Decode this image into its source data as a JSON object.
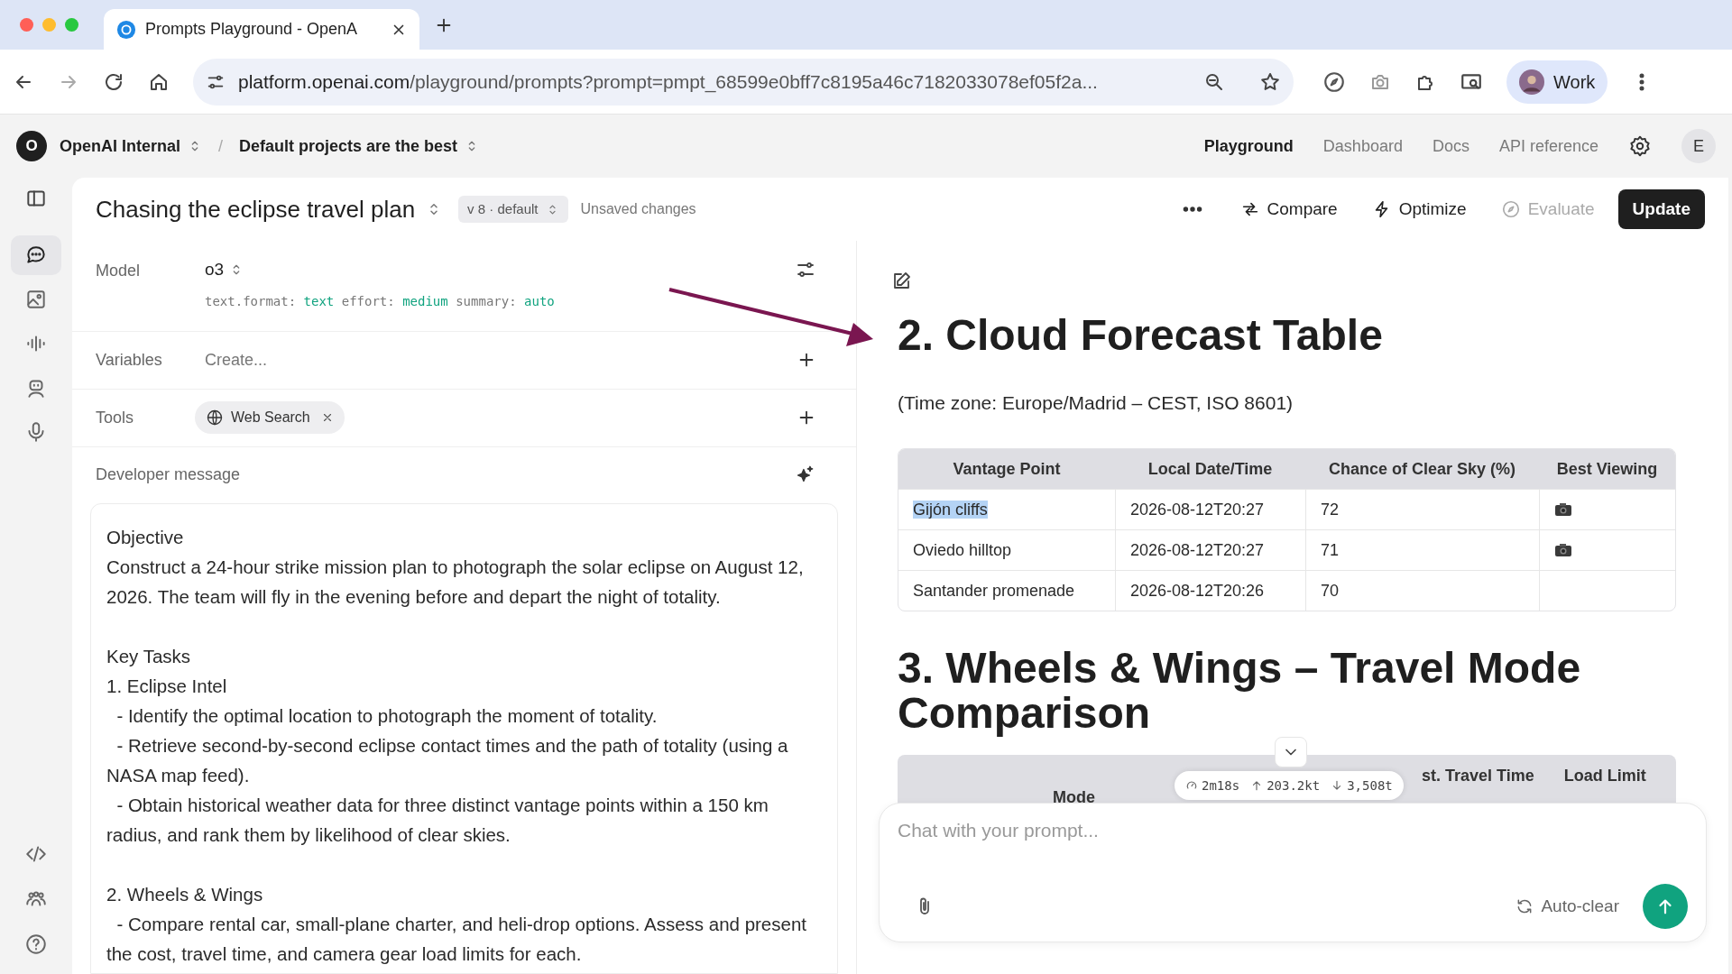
{
  "browser": {
    "tab_title": "Prompts Playground - OpenA",
    "url_host": "platform.openai.com",
    "url_path": "/playground/prompts?prompt=pmpt_68599e0bff7c8195a46c7182033078ef05f2a...",
    "profile": "Work"
  },
  "header": {
    "org_avatar": "O",
    "org": "OpenAI Internal",
    "separator": "/",
    "project": "Default projects are the best",
    "nav": [
      {
        "label": "Playground",
        "selected": true
      },
      {
        "label": "Dashboard",
        "selected": false
      },
      {
        "label": "Docs",
        "selected": false
      },
      {
        "label": "API reference",
        "selected": false
      }
    ],
    "user_avatar": "E"
  },
  "sidebar": {
    "items": [
      {
        "kind": "chat",
        "selected": true
      },
      {
        "kind": "image",
        "selected": false
      },
      {
        "kind": "audio",
        "selected": false
      },
      {
        "kind": "bot",
        "selected": false
      },
      {
        "kind": "mic",
        "selected": false
      }
    ]
  },
  "prompt": {
    "title": "Chasing the eclipse travel plan",
    "version": "v 8 · default",
    "status": "Unsaved changes",
    "actions": [
      {
        "label": "Compare",
        "kind": "compare",
        "disabled": false
      },
      {
        "label": "Optimize",
        "kind": "optimize",
        "disabled": false
      },
      {
        "label": "Evaluate",
        "kind": "evaluate",
        "disabled": true
      }
    ],
    "primary": "Update"
  },
  "config": {
    "model_label": "Model",
    "model": "o3",
    "params": [
      {
        "key": "text.format:",
        "value": "text"
      },
      {
        "key": "effort:",
        "value": "medium"
      },
      {
        "key": "summary:",
        "value": "auto"
      }
    ],
    "variables_label": "Variables",
    "variables_placeholder": "Create...",
    "tools_label": "Tools",
    "tools": [
      "Web Search"
    ],
    "developer_label": "Developer message"
  },
  "developer_message": [
    {
      "lines": [
        "Objective",
        "Construct a 24-hour strike mission plan to photograph the solar eclipse on August 12, 2026. The team will fly in the evening before and depart the night of totality."
      ]
    },
    {
      "lines": [
        "Key Tasks",
        "1. Eclipse Intel",
        "  - Identify the optimal location to photograph the moment of totality.",
        "  - Retrieve second-by-second eclipse contact times and the path of totality (using a NASA map feed).",
        "  - Obtain historical weather data for three distinct vantage points within a 150 km radius, and rank them by likelihood of clear skies."
      ]
    },
    {
      "lines": [
        "2. Wheels & Wings",
        "  - Compare rental car, small-plane charter, and heli-drop options. Assess and present the cost, travel time, and camera gear load limits for each."
      ]
    }
  ],
  "output": {
    "heading_1": "2. Cloud Forecast Table",
    "timezone": "(Time zone: Europe/Madrid – CEST, ISO 8601)",
    "table": {
      "columns": [
        "Vantage Point",
        "Local Date/Time",
        "Chance of Clear Sky (%)",
        "Best Viewing"
      ],
      "rows": [
        {
          "cells": [
            "Gijón cliffs",
            "2026-08-12T20:27",
            "72"
          ],
          "best_viewing": true,
          "selected": true
        },
        {
          "cells": [
            "Oviedo hilltop",
            "2026-08-12T20:27",
            "71"
          ],
          "best_viewing": true,
          "selected": false
        },
        {
          "cells": [
            "Santander promenade",
            "2026-08-12T20:26",
            "70"
          ],
          "best_viewing": false,
          "selected": false
        }
      ]
    },
    "heading_2": "3. Wheels & Wings – Travel Mode Comparison",
    "table_2_columns": [
      "Mode",
      "st. Travel Time",
      "Load Limit"
    ]
  },
  "stats": {
    "time": "2m18s",
    "input": "203.2kt",
    "output": "3,508t"
  },
  "chat": {
    "placeholder": "Chat with your prompt...",
    "auto_clear": "Auto-clear"
  }
}
